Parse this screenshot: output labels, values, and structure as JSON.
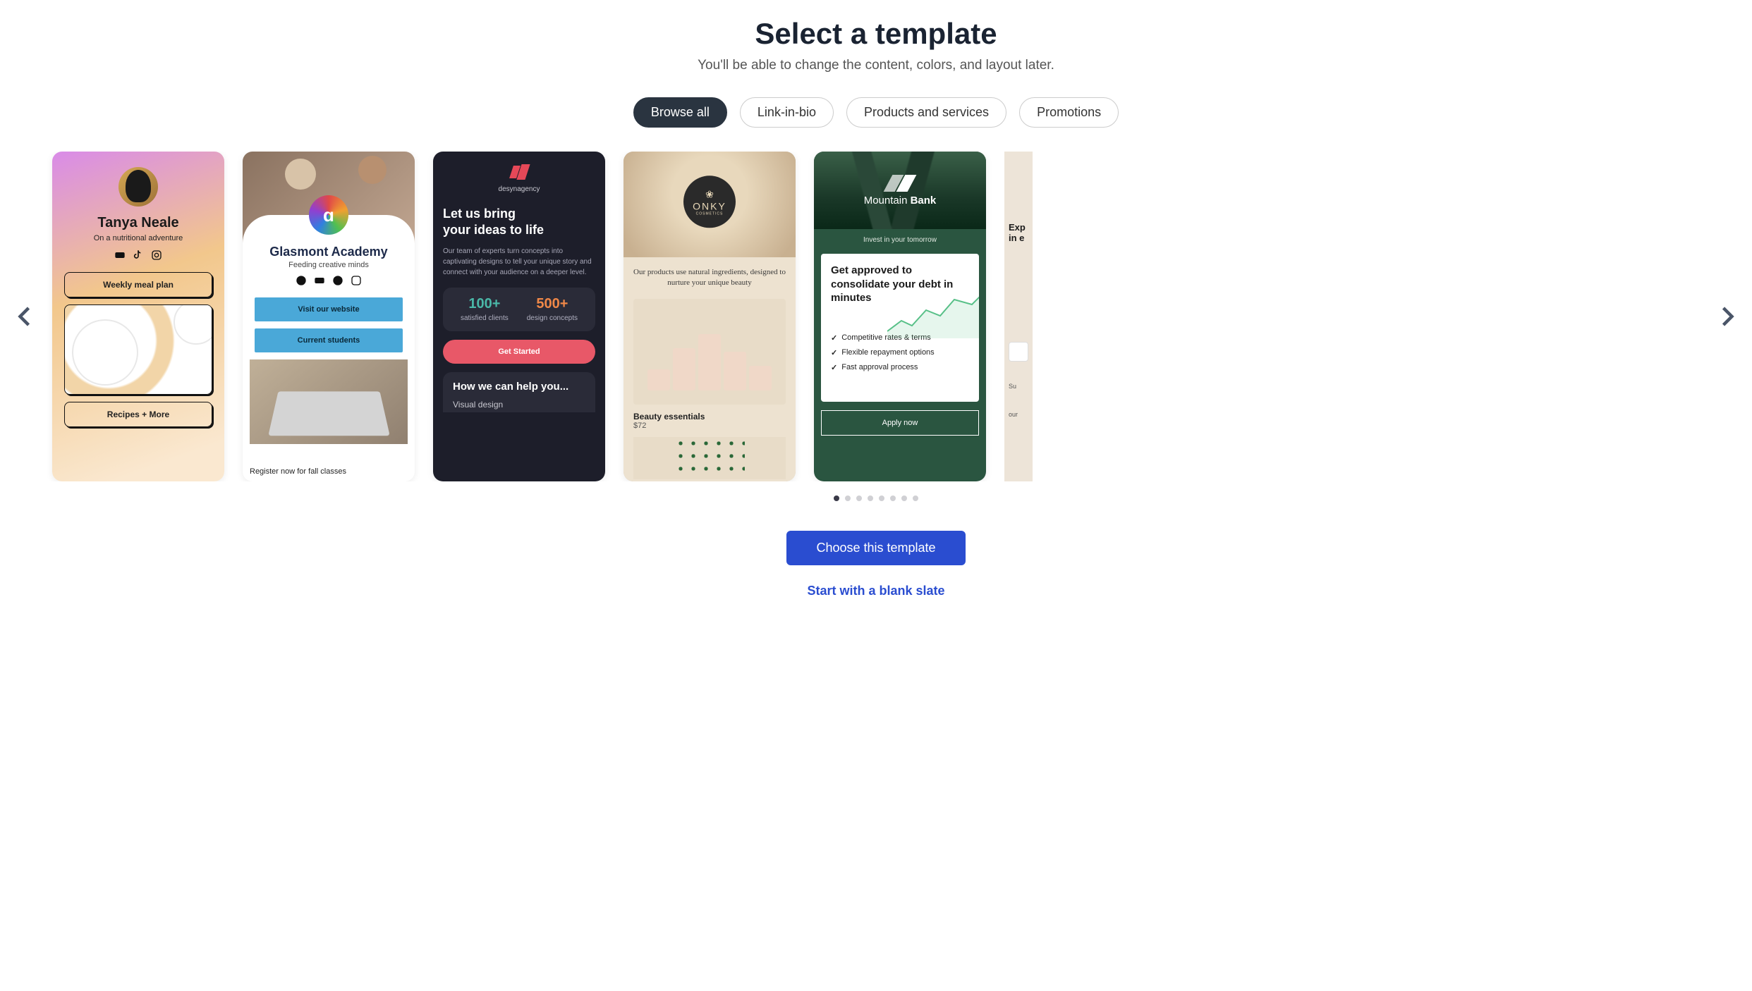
{
  "header": {
    "title": "Select a template",
    "subtitle": "You'll be able to change the content, colors, and layout later."
  },
  "filters": {
    "items": [
      {
        "label": "Browse all",
        "active": true
      },
      {
        "label": "Link-in-bio",
        "active": false
      },
      {
        "label": "Products and services",
        "active": false
      },
      {
        "label": "Promotions",
        "active": false
      }
    ]
  },
  "carousel": {
    "pagination": {
      "total": 8,
      "active_index": 0
    },
    "cards": {
      "tanya": {
        "name": "Tanya Neale",
        "tagline": "On a nutritional adventure",
        "social": [
          "youtube",
          "tiktok",
          "instagram"
        ],
        "btn1": "Weekly meal plan",
        "btn2": "Recipes + More"
      },
      "glasmont": {
        "name": "Glasmont Academy",
        "tagline": "Feeding creative minds",
        "social": [
          "x",
          "youtube",
          "facebook",
          "instagram"
        ],
        "btn1": "Visit our website",
        "btn2": "Current students",
        "caption": "Register now for fall classes"
      },
      "desyn": {
        "brand": "desynagency",
        "heading": "Let us bring\nyour ideas to life",
        "desc": "Our team of experts turn concepts into captivating designs to tell your unique story and connect with your audience on a deeper level.",
        "stat1_num": "100+",
        "stat1_lab": "satisfied clients",
        "stat2_num": "500+",
        "stat2_lab": "design concepts",
        "cta": "Get Started",
        "section_title": "How we can help you...",
        "section_item": "Visual design"
      },
      "onky": {
        "brand": "ONKY",
        "brand_sub": "COSMETICS",
        "tagline": "Our products use natural ingredients, designed to nurture your unique beauty",
        "product_name": "Beauty essentials",
        "product_price": "$72"
      },
      "bank": {
        "brand_pre": "Mountain ",
        "brand_bold": "Bank",
        "tagline": "Invest in your tomorrow",
        "card_title": "Get approved to consolidate your debt in minutes",
        "features": [
          "Competitive rates & terms",
          "Flexible repayment options",
          "Fast approval process"
        ],
        "cta": "Apply now"
      },
      "partial": {
        "title_frag": "Exp",
        "title_frag2": "in e",
        "sub_frag": "Su",
        "sub_frag2": "our"
      }
    }
  },
  "actions": {
    "primary": "Choose this template",
    "secondary": "Start with a blank slate"
  }
}
